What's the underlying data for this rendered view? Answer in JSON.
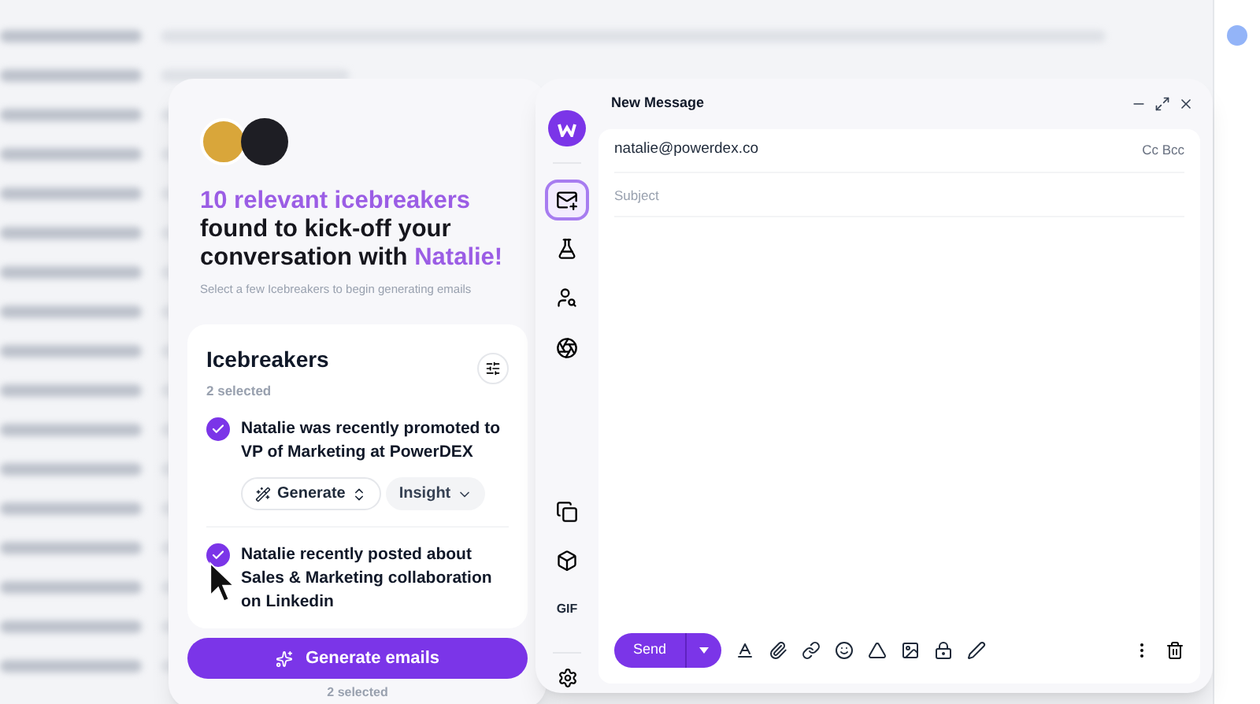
{
  "panel": {
    "headline_accent": "10 relevant icebreakers",
    "headline_rest": "found to kick-off your conversation with",
    "headline_name": "Natalie!",
    "subtitle": "Select a few Icebreakers to begin generating emails"
  },
  "icebreakers": {
    "title": "Icebreakers",
    "count": "2 selected",
    "items": [
      {
        "text": "Natalie was recently promoted to VP of Marketing at PowerDEX",
        "checked": true,
        "chips": [
          {
            "kind": "select",
            "label": "Generate"
          },
          {
            "kind": "dropdown",
            "label": "Insight"
          }
        ]
      },
      {
        "text": "Natalie recently posted about Sales & Marketing collaboration on Linkedin",
        "checked": true
      }
    ]
  },
  "generate": {
    "label": "Generate emails",
    "caption": "2 selected"
  },
  "compose": {
    "title": "New Message",
    "to": "natalie@powerdex.co",
    "cc_bcc": "Cc Bcc",
    "subject_placeholder": "Subject",
    "send": "Send",
    "rail": [
      {
        "kind": "icon",
        "selected": true
      },
      {
        "kind": "icon",
        "selected": false
      },
      {
        "kind": "icon",
        "selected": false
      },
      {
        "kind": "icon",
        "selected": false
      },
      {
        "kind": "icon",
        "selected": false
      },
      {
        "kind": "icon",
        "selected": false
      },
      {
        "kind": "text",
        "label": "GIF",
        "selected": false
      }
    ]
  }
}
